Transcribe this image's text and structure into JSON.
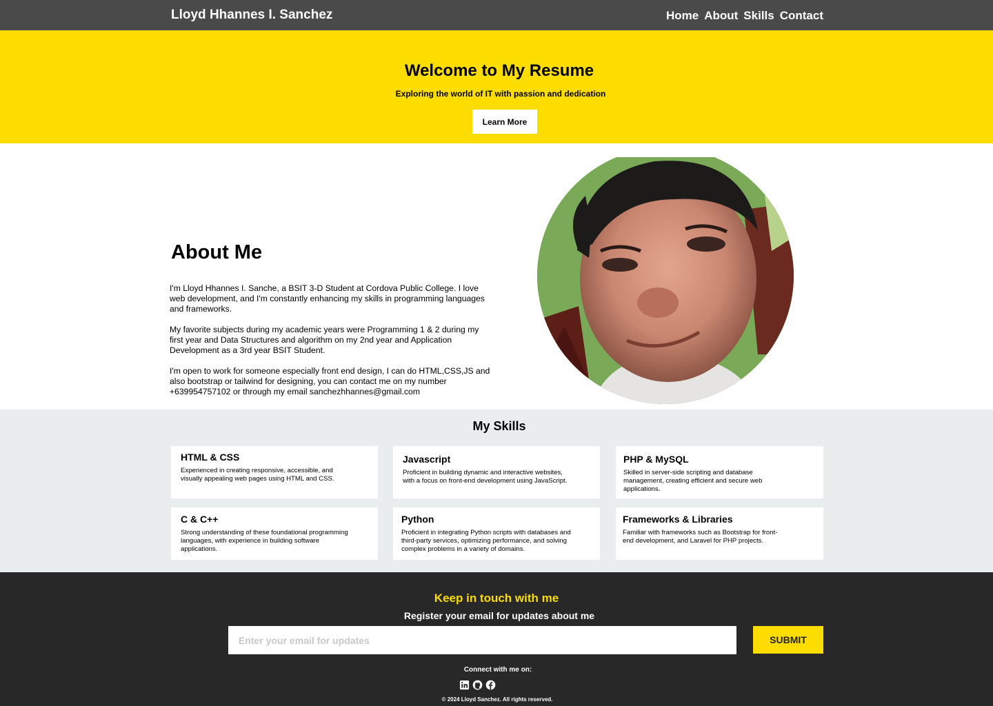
{
  "navbar": {
    "brand": "Lloyd Hhannes I. Sanchez",
    "links": [
      "Home",
      "About",
      "Skills",
      "Contact"
    ]
  },
  "hero": {
    "title": "Welcome to My Resume",
    "subtitle": "Exploring the world of IT with passion and dedication",
    "button_label": "Learn More"
  },
  "about": {
    "title": "About Me",
    "paragraphs": [
      "I'm Lloyd Hhannes I. Sanche, a BSIT 3-D Student at Cordova Public College. I love web development, and I'm constantly enhancing my skills in programming languages and frameworks.",
      "My favorite subjects during my academic years were Programming 1 & 2 during my first year and Data Structures and algorithm on my 2nd year and Application Development as a 3rd year BSIT Student.",
      "I'm open to work for someone especially front end design, I can do HTML,CSS,JS and also bootstrap or tailwind for designing, you can contact me on my number +639954757102 or through my email sanchezhhannes@gmail.com"
    ]
  },
  "skills": {
    "title": "My Skills",
    "cards": [
      {
        "title": "HTML & CSS",
        "desc": "Experienced in creating responsive, accessible, and visually appealing web pages using HTML and CSS."
      },
      {
        "title": "Javascript",
        "desc": "Proficient in building dynamic and interactive websites, with a focus on front-end development using JavaScript."
      },
      {
        "title": "PHP & MySQL",
        "desc": "Skilled in server-side scripting and database management, creating efficient and secure web applications."
      },
      {
        "title": "C & C++",
        "desc": "Strong understanding of these foundational programming languages, with experience in building software applications."
      },
      {
        "title": "Python",
        "desc": "Proficient in integrating Python scripts with databases and third-party services, optimizing performance, and solving complex problems in a variety of domains."
      },
      {
        "title": "Frameworks & Libraries",
        "desc": "Familiar with frameworks such as Bootstrap for front-end development, and Laravel for PHP projects."
      }
    ]
  },
  "footer": {
    "title": "Keep in touch with me",
    "subtitle": "Register your email for  updates about me",
    "email_placeholder": "Enter your email for updates",
    "submit_label": "SUBMIT",
    "connect_label": "Connect with me on:",
    "socials": [
      "linkedin-icon",
      "github-icon",
      "facebook-icon"
    ],
    "copyright": "© 2024 Lloyd Sanchez. All rights reserved."
  },
  "colors": {
    "navbar": "#4a4a4a",
    "accent_yellow": "#fddd00",
    "skills_bg": "#e9eded",
    "footer_bg": "#282828"
  }
}
